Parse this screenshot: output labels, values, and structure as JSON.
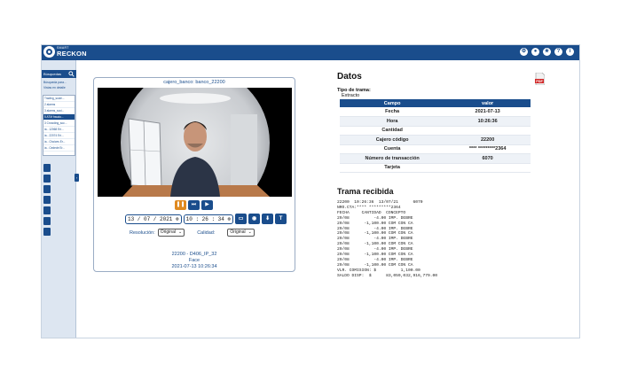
{
  "app": {
    "brand_small": "SMART",
    "brand_name": "RECKON"
  },
  "topbar": {
    "icons": [
      "gear-icon",
      "user-icon",
      "star-icon",
      "help-icon",
      "info-icon"
    ]
  },
  "sidebar": {
    "search_label": "Búsquedas",
    "links": [
      "Búsqueda para...",
      "Vistas en detalle"
    ],
    "results": [
      "Trading_socie...",
      "2 alarms",
      "3 alarms_soci...",
      "5 ATM fraudu...",
      "3 Crowding_soc...",
      "ia - 12068 Eri...",
      "ia - 22074 Eri...",
      "ia - Choices Er...",
      "ia - Cedede Er..."
    ],
    "selected_index": 3
  },
  "video": {
    "title": "cajero_banco: banco_22200",
    "date_value": "13 / 07 / 2021",
    "time_value": "10 : 26 : 34",
    "resolution_label": "Resolución:",
    "resolution_value": "Original",
    "quality_label": "Calidad:",
    "quality_value": "Original",
    "camera_id": "22200 - D406_IP_32",
    "event_type": "Face",
    "timestamp": "2021-07-13 10:26:34"
  },
  "datos": {
    "title": "Datos",
    "tipo_label": "Tipo de trama:",
    "tipo_value": "Extracto",
    "table_headers": [
      "Campo",
      "valor"
    ],
    "rows": [
      {
        "campo": "Fecha",
        "valor": "2021-07-13"
      },
      {
        "campo": "Hora",
        "valor": "10:26:36"
      },
      {
        "campo": "Cantidad",
        "valor": ""
      },
      {
        "campo": "Cajero código",
        "valor": "22200"
      },
      {
        "campo": "Cuenta",
        "valor": "**** *********2364"
      },
      {
        "campo": "Número de transacción",
        "valor": "6070"
      },
      {
        "campo": "Tarjeta",
        "valor": ""
      }
    ]
  },
  "trama": {
    "title": "Trama recibida",
    "text": "22200  10:26:36  13/07/21      6070\nNRO.CTA:**** *********2364\nFECHA     CANTIDAD  CONCEPTO\n29/08          -4.00 IMP. DEBRE\n29/08      -1,100.00 COM CON CA\n29/08          -4.00 IMP. DEBRE\n29/08      -1,100.00 COM CON CA\n29/08          -4.00 IMP. DEBRE\n29/08      -1,100.00 COM CON CA\n29/08          -4.00 IMP. DEBRE\n29/08      -1,100.00 COM CON CA\n29/08          -4.00 IMP. DEBRE\n29/08      -1,100.00 COM CON CA\nVLR. COMISION: $          1,100.00\nSALDO DISP:  $      83,059,032,916,779.00"
  },
  "colors": {
    "brand": "#1a4d8c",
    "pause": "#e08a20"
  }
}
